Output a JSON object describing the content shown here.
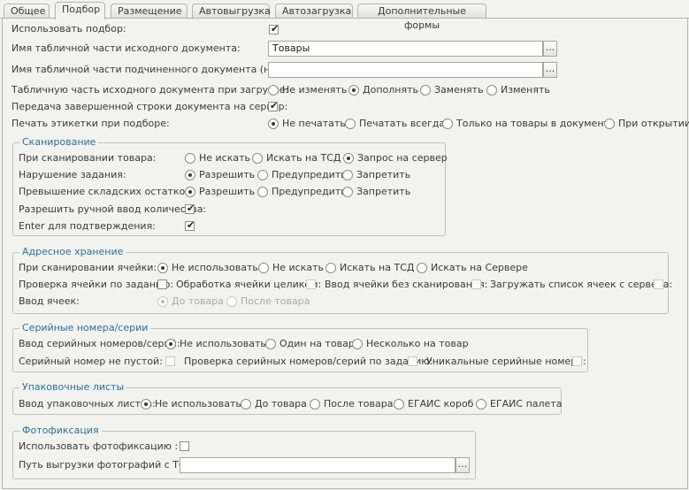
{
  "tabs": [
    "Общее",
    "Подбор",
    "Размещение",
    "Автовыгрузка",
    "Автозагрузка",
    "Дополнительные формы"
  ],
  "active_tab": "Подбор",
  "general": {
    "use_selection_label": "Использовать подбор:",
    "use_selection_checked": true,
    "source_table_label": "Имя табличной части исходного документа:",
    "source_table_value": "Товары",
    "sub_table_label": "Имя табличной части подчиненного документа (нового):",
    "sub_table_value": "",
    "load_mode_label": "Табличную часть исходного документа при загрузке:",
    "load_mode_options": [
      "Не изменять",
      "Дополнять",
      "Заменять",
      "Изменять"
    ],
    "load_mode_selected": "Дополнять",
    "send_row_label": "Передача завершенной строки документа на сервер:",
    "send_row_checked": true,
    "print_labels_label": "Печать этикетки при подборе:",
    "print_labels_options": [
      "Не печатать",
      "Печатать всегда",
      "Только на товары в документе",
      "При открытии"
    ],
    "print_labels_selected": "Не печатать",
    "browse_button": "..."
  },
  "scanning": {
    "title": "Сканирование",
    "on_scan_label": "При сканировании товара:",
    "on_scan_options": [
      "Не искать",
      "Искать на ТСД",
      "Запрос на сервер"
    ],
    "on_scan_selected": "Запрос на сервер",
    "task_violation_label": "Нарушение задания:",
    "task_violation_options": [
      "Разрешить",
      "Предупредить",
      "Запретить"
    ],
    "task_violation_selected": "Разрешить",
    "stock_excess_label": "Превышение складских остатков:",
    "stock_excess_options": [
      "Разрешить",
      "Предупредить",
      "Запретить"
    ],
    "stock_excess_selected": "Разрешить",
    "manual_qty_label": "Разрешить ручной ввод количества:",
    "manual_qty_checked": true,
    "enter_confirm_label": "Enter для подтверждения:",
    "enter_confirm_checked": true
  },
  "address": {
    "title": "Адресное хранение",
    "cell_scan_label": "При сканировании ячейки:",
    "cell_scan_options": [
      "Не использовать",
      "Не искать",
      "Искать на ТСД",
      "Искать на Сервере"
    ],
    "cell_scan_selected": "Не использовать",
    "check_cell_label": "Проверка ячейки по заданию:",
    "check_cell_checked": false,
    "whole_cell_label": "Обработка ячейки целиком:",
    "whole_cell_checked": false,
    "no_scan_label": "Ввод ячейки без сканирования:",
    "no_scan_checked": false,
    "load_cells_label": "Загружать список ячеек с сервера:",
    "load_cells_checked": false,
    "cell_input_label": "Ввод ячеек:",
    "cell_input_options": [
      "До товара",
      "После товара"
    ],
    "cell_input_selected": "До товара"
  },
  "serial": {
    "title": "Серийные номера/серии",
    "input_label": "Ввод серийных номеров/серий:",
    "input_options": [
      "Не использовать",
      "Один на товар",
      "Несколько на товар"
    ],
    "input_selected": "Не использовать",
    "not_empty_label": "Серийный номер не пустой:",
    "not_empty_checked": false,
    "check_task_label": "Проверка серийных номеров/серий по заданию:",
    "check_task_checked": false,
    "unique_label": "Уникальные серийные номера:",
    "unique_checked": false
  },
  "packing": {
    "title": "Упаковочные листы",
    "input_label": "Ввод упаковочных листов:",
    "input_options": [
      "Не использовать",
      "До товара",
      "После товара",
      "ЕГАИС короб",
      "ЕГАИС палета"
    ],
    "input_selected": "Не использовать"
  },
  "photo": {
    "title": "Фотофиксация",
    "use_label": "Использовать фотофиксацию :",
    "use_checked": false,
    "path_label": "Путь выгрузки фотографий с ТСД:",
    "path_value": ""
  },
  "colors": {
    "background": "#f2f2ef",
    "group_title": "#2f6f95",
    "text": "#3a3a3a"
  }
}
